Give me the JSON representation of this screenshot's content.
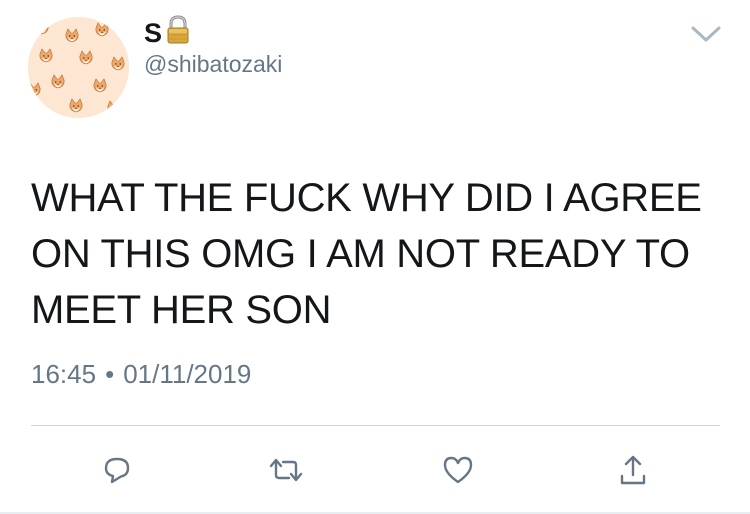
{
  "tweet": {
    "display_name": "S",
    "handle": "@shibatozaki",
    "text": "WHAT THE FUCK WHY DID I AGREE ON THIS OMG I AM NOT READY TO MEET HER SON",
    "time": "16:45",
    "separator": "•",
    "date": "01/11/2019",
    "protected_icon": "lock-icon",
    "menu_icon": "chevron-down-icon"
  },
  "actions": [
    {
      "name": "reply-button",
      "icon": "reply-icon"
    },
    {
      "name": "retweet-button",
      "icon": "retweet-icon"
    },
    {
      "name": "like-button",
      "icon": "heart-icon"
    },
    {
      "name": "share-button",
      "icon": "share-icon"
    }
  ],
  "colors": {
    "text": "#14171a",
    "secondary": "#657786",
    "divider": "#ccd6dd",
    "avatar_bg": "#fde7d2"
  }
}
